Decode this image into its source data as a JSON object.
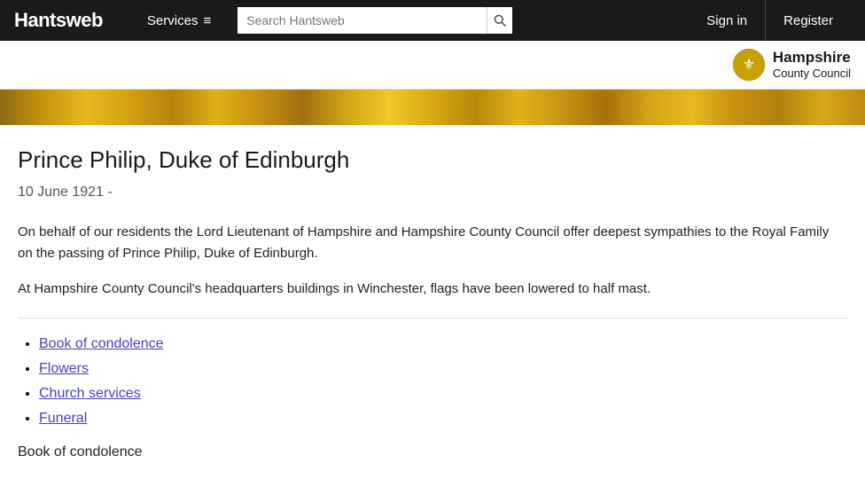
{
  "header": {
    "logo": "Hantsweb",
    "services_label": "Services",
    "services_icon": "≡",
    "search_placeholder": "Search Hantsweb",
    "sign_in_label": "Sign in",
    "register_label": "Register"
  },
  "council": {
    "name_line1": "Hampshire",
    "name_line2": "County Council"
  },
  "page": {
    "title": "Prince Philip, Duke of Edinburgh",
    "dates": "10 June 1921 -",
    "body_paragraph1": "On behalf of our residents the Lord Lieutenant of Hampshire and Hampshire County Council offer deepest sympathies to the Royal Family on the passing of Prince Philip, Duke of Edinburgh.",
    "body_paragraph2": "At Hampshire County Council's headquarters buildings in Winchester, flags have been lowered to half mast.",
    "links": [
      {
        "label": "Book of condolence",
        "href": "#"
      },
      {
        "label": "Flowers",
        "href": "#"
      },
      {
        "label": "Church services",
        "href": "#"
      },
      {
        "label": "Funeral",
        "href": "#"
      }
    ],
    "footer_section_title": "Book of condolence"
  }
}
